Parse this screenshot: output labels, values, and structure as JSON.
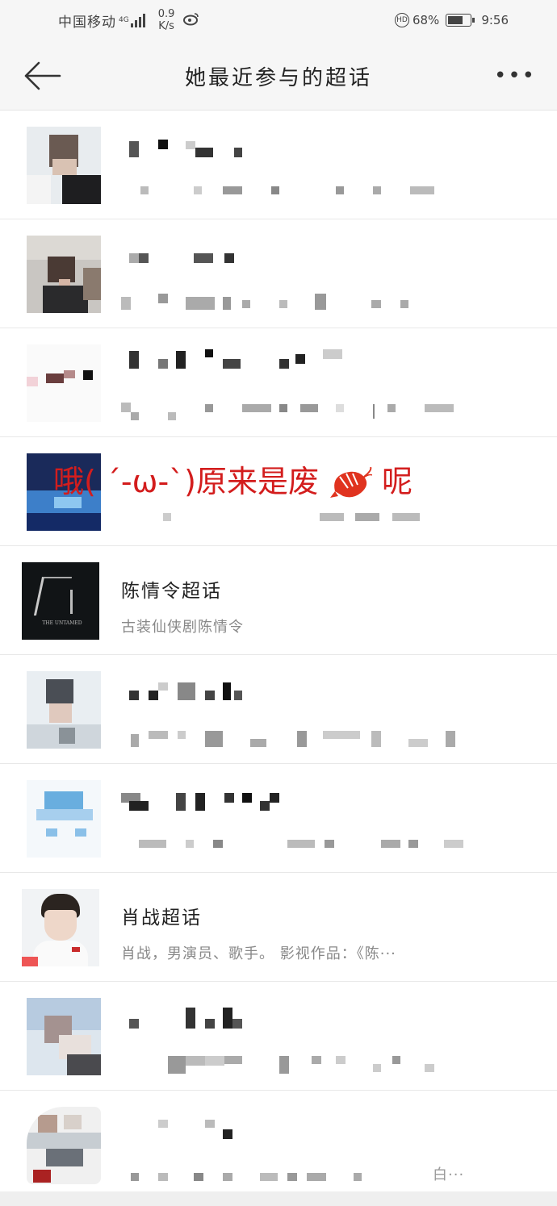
{
  "status_bar": {
    "carrier": "中国移动",
    "network": "4G",
    "speed_value": "0.9",
    "speed_unit": "K/s",
    "hd_badge": "HD",
    "battery": "68%",
    "time": "9:56"
  },
  "nav": {
    "title": "她最近参与的超话",
    "more_label": "•••"
  },
  "items": [
    {
      "title": "",
      "subtitle": "",
      "censored": true
    },
    {
      "title": "",
      "subtitle": "",
      "censored": true
    },
    {
      "title": "",
      "subtitle": "",
      "censored": true
    },
    {
      "title": "",
      "subtitle": "",
      "censored": true
    },
    {
      "title": "陈情令超话",
      "subtitle": "古装仙侠剧陈情令",
      "avatar_text": "THE UNTAMED",
      "censored": false
    },
    {
      "title": "",
      "subtitle": "",
      "censored": true
    },
    {
      "title": "",
      "subtitle": "",
      "censored": true
    },
    {
      "title": "肖战超话",
      "subtitle": "肖战，男演员、歌手。 影视作品：《陈···",
      "censored": false
    },
    {
      "title": "",
      "subtitle": "",
      "censored": true
    },
    {
      "title": "",
      "subtitle": "白···",
      "censored": true
    }
  ],
  "overlay_text": "哦(  ˊ-ω-ˋ)原来是废",
  "overlay_text_end": "呢",
  "colors": {
    "nav_bg": "#f6f6f6",
    "scribble": "#d31d1d",
    "divider": "#e8e8e8"
  }
}
